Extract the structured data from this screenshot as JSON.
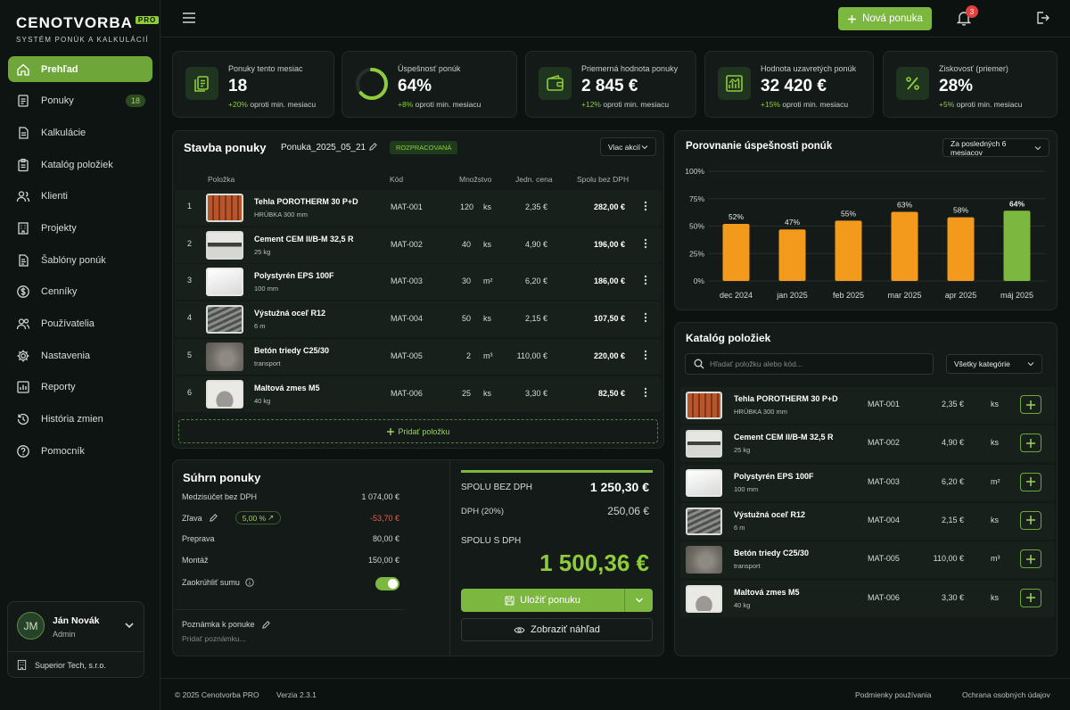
{
  "app": {
    "logo": "CENOTVORBA",
    "logo_badge": "PRO",
    "tagline": "SYSTÉM PONÚK A KALKULÁCIÍ"
  },
  "sidebar": {
    "items": [
      {
        "label": "Prehľad",
        "icon": "home-icon",
        "active": true
      },
      {
        "label": "Ponuky",
        "icon": "document-icon",
        "badge": "18"
      },
      {
        "label": "Kalkulácie",
        "icon": "file-icon"
      },
      {
        "label": "Katalóg položiek",
        "icon": "clipboard-icon"
      },
      {
        "label": "Klienti",
        "icon": "users-icon"
      },
      {
        "label": "Projekty",
        "icon": "building-icon"
      },
      {
        "label": "Šablóny ponúk",
        "icon": "template-icon"
      },
      {
        "label": "Cenníky",
        "icon": "dollar-icon"
      },
      {
        "label": "Používatelia",
        "icon": "user-group-icon"
      },
      {
        "label": "Nastavenia",
        "icon": "gear-icon"
      },
      {
        "label": "Reporty",
        "icon": "chart-icon"
      },
      {
        "label": "História zmien",
        "icon": "history-icon"
      },
      {
        "label": "Pomocník",
        "icon": "help-icon"
      }
    ],
    "user": {
      "initials": "JM",
      "name": "Ján Novák",
      "role": "Admin",
      "company": "Superior Tech, s.r.o."
    }
  },
  "topbar": {
    "new_button": "Nová ponuka",
    "notifications": "3"
  },
  "stats": [
    {
      "label": "Ponuky tento mesiac",
      "value": "18",
      "delta": "+20%",
      "delta_text": "oproti min. mesiacu",
      "icon": "documents-icon"
    },
    {
      "label": "Úspešnosť ponúk",
      "value": "64%",
      "delta": "+8%",
      "delta_text": "oproti min. mesiacu",
      "icon": "progress-ring-icon",
      "progress": 0.64
    },
    {
      "label": "Priemerná hodnota ponuky",
      "value": "2 845 €",
      "delta": "+12%",
      "delta_text": "oproti min. mesiacu",
      "icon": "wallet-icon"
    },
    {
      "label": "Hodnota uzavretých ponúk",
      "value": "32 420 €",
      "delta": "+15%",
      "delta_text": "oproti min. mesiacu",
      "icon": "chart-icon"
    },
    {
      "label": "Ziskovosť (priemer)",
      "value": "28%",
      "delta": "+5%",
      "delta_text": "oproti min. mesiacu",
      "icon": "percent-icon"
    }
  ],
  "builder": {
    "title": "Stavba ponuky",
    "doc_name": "Ponuka_2025_05_21",
    "status": "ROZPRACOVANÁ",
    "actions": "Viac akcií",
    "columns": [
      "Položka",
      "Kód",
      "Množstvo",
      "Jedn. cena",
      "Spolu bez DPH"
    ],
    "rows": [
      {
        "n": "1",
        "name": "Tehla POROTHERM 30 P+D",
        "sub": "HRÚBKA 300 mm",
        "code": "MAT-001",
        "qty": "120",
        "unit": "ks",
        "price": "2,35 €",
        "total": "282,00 €",
        "thumb": "brick"
      },
      {
        "n": "2",
        "name": "Cement CEM II/B-M 32,5 R",
        "sub": "25 kg",
        "code": "MAT-002",
        "qty": "40",
        "unit": "ks",
        "price": "4,90 €",
        "total": "196,00 €",
        "thumb": "bag"
      },
      {
        "n": "3",
        "name": "Polystyrén EPS 100F",
        "sub": "100 mm",
        "code": "MAT-003",
        "qty": "30",
        "unit": "m²",
        "price": "6,20 €",
        "total": "186,00 €",
        "thumb": "eps"
      },
      {
        "n": "4",
        "name": "Výstužná oceľ R12",
        "sub": "6 m",
        "code": "MAT-004",
        "qty": "50",
        "unit": "ks",
        "price": "2,15 €",
        "total": "107,50 €",
        "thumb": "rebar"
      },
      {
        "n": "5",
        "name": "Betón triedy C25/30",
        "sub": "transport",
        "code": "MAT-005",
        "qty": "2",
        "unit": "m³",
        "price": "110,00 €",
        "total": "220,00 €",
        "thumb": "conc"
      },
      {
        "n": "6",
        "name": "Maltová zmes M5",
        "sub": "40 kg",
        "code": "MAT-006",
        "qty": "25",
        "unit": "ks",
        "price": "3,30 €",
        "total": "82,50 €",
        "thumb": "mortar"
      }
    ],
    "add_item": "Pridať položku"
  },
  "summary": {
    "title": "Súhrn ponuky",
    "subtotal_label": "Medzisúčet bez DPH",
    "subtotal": "1 074,00 €",
    "discount_label": "Zľava",
    "discount_pct": "5,00 %",
    "discount": "-53,70 €",
    "shipping_label": "Preprava",
    "shipping": "80,00 €",
    "assembly_label": "Montáž",
    "assembly": "150,00 €",
    "round_label": "Zaokrúhliť sumu",
    "note_label": "Poznámka k ponuke",
    "note_placeholder": "Pridať poznámku...",
    "total_no_vat_label": "SPOLU BEZ DPH",
    "total_no_vat": "1 250,30 €",
    "vat_label": "DPH (20%)",
    "vat": "250,06 €",
    "total_vat_label": "SPOLU S DPH",
    "total_vat": "1 500,36 €",
    "save_button": "Uložiť ponuku",
    "preview_button": "Zobraziť náhľad"
  },
  "chart": {
    "title": "Porovnanie úspešnosti ponúk",
    "period": "Za posledných 6 mesiacov"
  },
  "chart_data": {
    "type": "bar",
    "title": "Porovnanie úspešnosti ponúk",
    "categories": [
      "dec 2024",
      "jan 2025",
      "feb 2025",
      "mar 2025",
      "apr 2025",
      "máj 2025"
    ],
    "values": [
      52,
      47,
      55,
      63,
      58,
      64
    ],
    "value_labels": [
      "52%",
      "47%",
      "55%",
      "63%",
      "58%",
      "64%"
    ],
    "y_ticks": [
      "0%",
      "25%",
      "50%",
      "75%",
      "100%"
    ],
    "ylim": [
      0,
      100
    ],
    "colors": {
      "default": "#f39a1c",
      "highlight": "#7cb83f"
    },
    "grid": true
  },
  "catalog": {
    "title": "Katalóg položiek",
    "search_placeholder": "Hľadať položku alebo kód...",
    "filter": "Všetky kategórie",
    "items": [
      {
        "name": "Tehla POROTHERM 30 P+D",
        "sub": "HRÚBKA 300 mm",
        "code": "MAT-001",
        "price": "2,35 €",
        "unit": "ks",
        "thumb": "brick"
      },
      {
        "name": "Cement CEM II/B-M 32,5 R",
        "sub": "25 kg",
        "code": "MAT-002",
        "price": "4,90 €",
        "unit": "ks",
        "thumb": "bag"
      },
      {
        "name": "Polystyrén EPS 100F",
        "sub": "100 mm",
        "code": "MAT-003",
        "price": "6,20 €",
        "unit": "m²",
        "thumb": "eps"
      },
      {
        "name": "Výstužná oceľ R12",
        "sub": "6 m",
        "code": "MAT-004",
        "price": "2,15 €",
        "unit": "ks",
        "thumb": "rebar"
      },
      {
        "name": "Betón triedy C25/30",
        "sub": "transport",
        "code": "MAT-005",
        "price": "110,00 €",
        "unit": "m³",
        "thumb": "conc"
      },
      {
        "name": "Maltová zmes M5",
        "sub": "40 kg",
        "code": "MAT-006",
        "price": "3,30 €",
        "unit": "ks",
        "thumb": "mortar"
      }
    ]
  },
  "footer": {
    "copyright": "© 2025 Cenotvorba PRO",
    "version": "Verzia 2.3.1",
    "terms": "Podmienky používania",
    "privacy": "Ochrana osobných údajov"
  }
}
